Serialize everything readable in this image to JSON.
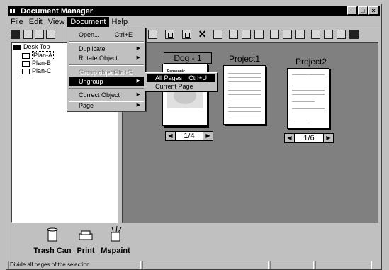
{
  "window": {
    "title": "Document Manager",
    "buttons": {
      "minimize": "_",
      "maximize": "□",
      "close": "×"
    }
  },
  "menubar": [
    {
      "label": "File"
    },
    {
      "label": "Edit"
    },
    {
      "label": "View"
    },
    {
      "label": "Document"
    },
    {
      "label": "Help"
    }
  ],
  "document_menu": {
    "items": [
      {
        "label": "Open...",
        "shortcut": "Ctrl+E"
      },
      {
        "label": "Duplicate"
      },
      {
        "label": "Rotate Object"
      },
      {
        "label": "Group objects",
        "shortcut": "Ctrl+G"
      },
      {
        "label": "Ungroup"
      },
      {
        "label": "Correct Object"
      },
      {
        "label": "Page"
      }
    ]
  },
  "ungroup_submenu": {
    "items": [
      {
        "label": "All Pages",
        "shortcut": "Ctrl+U"
      },
      {
        "label": "Current Page"
      }
    ]
  },
  "tree": {
    "root": "Desk Top",
    "children": [
      "Plan-A",
      "Plan-B",
      "Plan-C"
    ]
  },
  "documents": [
    {
      "title": "Dog - 1",
      "pager": "1/4",
      "cover_brand": "Panasonic"
    },
    {
      "title": "Project1"
    },
    {
      "title": "Project2",
      "pager": "1/6"
    }
  ],
  "dock": [
    {
      "label": "Trash Can"
    },
    {
      "label": "Print"
    },
    {
      "label": "Mspaint"
    }
  ],
  "status": {
    "message": "Divide all pages of the selection."
  }
}
